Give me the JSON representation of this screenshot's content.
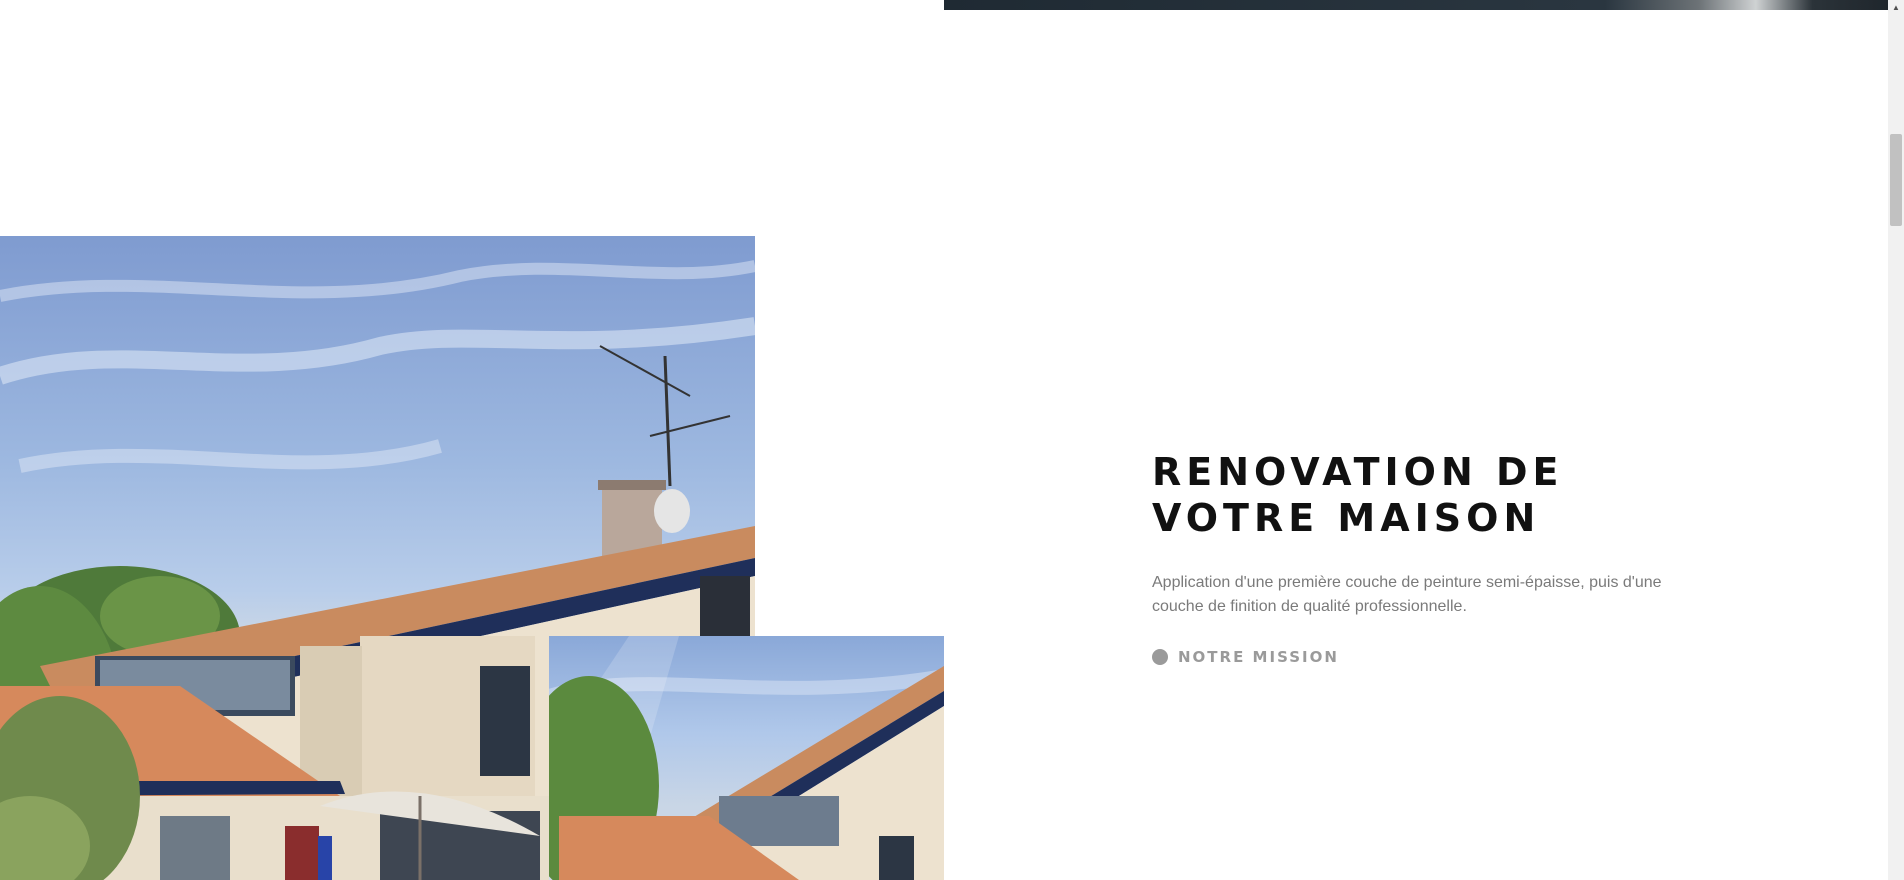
{
  "section": {
    "heading_line1": "RENOVATION DE",
    "heading_line2": "VOTRE MAISON",
    "description": "Application d'une première couche de peinture semi-épaisse, puis d'une couche de finition de qualité professionnelle.",
    "cta_label": "NOTRE MISSION",
    "cta_icon": "dot-icon"
  },
  "colors": {
    "heading": "#111111",
    "body_text": "#7a7a7a",
    "cta": "#9a9a9a",
    "dark_band": "#1f2a33"
  },
  "images": {
    "main_photo": "house-exterior-photo",
    "inset_photo": "house-exterior-detail-photo"
  },
  "scrollbar": {
    "up_arrow_icon": "scroll-up-arrow-icon"
  }
}
